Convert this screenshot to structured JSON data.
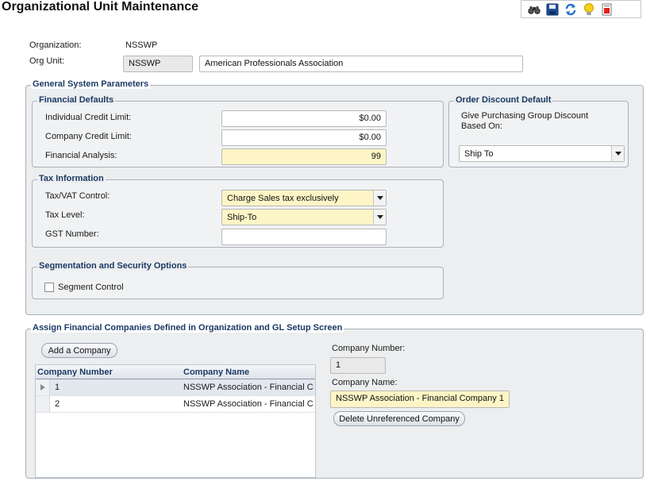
{
  "page": {
    "title": "Organizational Unit Maintenance"
  },
  "toolbar": {
    "buttons": [
      "binoculars-icon",
      "save-icon",
      "refresh-icon",
      "lightbulb-icon",
      "report-icon"
    ]
  },
  "header": {
    "organization_label": "Organization:",
    "organization_value": "NSSWP",
    "org_unit_label": "Org Unit:",
    "org_unit_code": "NSSWP",
    "org_unit_name": "American Professionals Association"
  },
  "general": {
    "legend": "General System Parameters",
    "financial": {
      "legend": "Financial Defaults",
      "individual_credit_label": "Individual Credit Limit:",
      "individual_credit_value": "$0.00",
      "company_credit_label": "Company Credit Limit:",
      "company_credit_value": "$0.00",
      "financial_analysis_label": "Financial Analysis:",
      "financial_analysis_value": "99"
    },
    "order_discount": {
      "legend": "Order Discount Default",
      "give_label_line1": "Give Purchasing Group Discount",
      "give_label_line2": "Based On:",
      "selected": "Ship To"
    },
    "tax": {
      "legend": "Tax Information",
      "vat_label": "Tax/VAT Control:",
      "vat_value": "Charge Sales tax exclusively",
      "level_label": "Tax Level:",
      "level_value": "Ship-To",
      "gst_label": "GST Number:",
      "gst_value": ""
    },
    "segmentation": {
      "legend": "Segmentation and Security Options",
      "segment_control_label": "Segment Control",
      "segment_control_checked": false
    }
  },
  "companies": {
    "legend": "Assign Financial Companies Defined in Organization and GL Setup Screen",
    "add_button": "Add a Company",
    "columns": [
      "Company Number",
      "Company Name"
    ],
    "rows": [
      {
        "number": "1",
        "name": "NSSWP Association - Financial C"
      },
      {
        "number": "2",
        "name": "NSSWP Association - Financial C"
      }
    ],
    "detail": {
      "number_label": "Company Number:",
      "number_value": "1",
      "name_label": "Company Name:",
      "name_value": "NSSWP Association - Financial Company 1",
      "delete_button": "Delete Unreferenced Company"
    }
  }
}
